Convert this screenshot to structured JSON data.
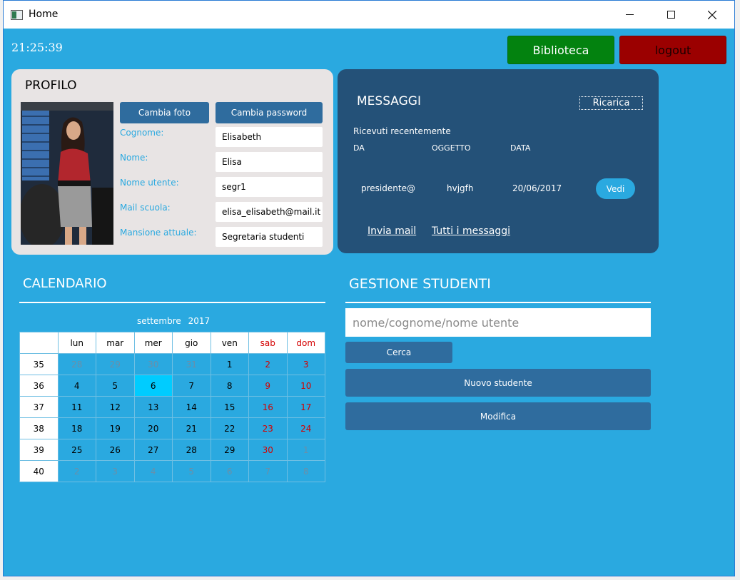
{
  "window": {
    "title": "Home"
  },
  "clock": "21:25:39",
  "top_buttons": {
    "library": "Biblioteca",
    "logout": "logout"
  },
  "colors": {
    "background": "#2aa9e0",
    "library": "#03820f",
    "logout": "#9b0000",
    "panel_dark": "#245178",
    "button": "#2f6c9e",
    "today": "#00ccff",
    "weekend": "#d40000"
  },
  "profile": {
    "title": "PROFILO",
    "change_photo": "Cambia foto",
    "change_password": "Cambia password",
    "fields": [
      {
        "label": "Cognome:",
        "value": "Elisabeth"
      },
      {
        "label": "Nome:",
        "value": "Elisa"
      },
      {
        "label": "Nome utente:",
        "value": "segr1"
      },
      {
        "label": "Mail scuola:",
        "value": "elisa_elisabeth@mail.it"
      },
      {
        "label": "Mansione attuale:",
        "value": "Segretaria studenti"
      }
    ]
  },
  "messages": {
    "title": "MESSAGGI",
    "reload": "Ricarica",
    "recent": "Ricevuti recentemente",
    "columns": [
      "DA",
      "OGGETTO",
      "DATA"
    ],
    "row": {
      "from": "presidente@r",
      "subject": "hvjgfh",
      "date": "20/06/2017",
      "view": "Vedi"
    },
    "send_mail": "Invia mail",
    "all_messages": "Tutti i messaggi"
  },
  "calendar": {
    "title": "CALENDARIO",
    "month": "settembre",
    "year": "2017",
    "days": [
      "lun",
      "mar",
      "mer",
      "gio",
      "ven",
      "sab",
      "dom"
    ],
    "weeks": [
      {
        "n": "35",
        "d": [
          "28",
          "29",
          "30",
          "31",
          "1",
          "2",
          "3"
        ]
      },
      {
        "n": "36",
        "d": [
          "4",
          "5",
          "6",
          "7",
          "8",
          "9",
          "10"
        ]
      },
      {
        "n": "37",
        "d": [
          "11",
          "12",
          "13",
          "14",
          "15",
          "16",
          "17"
        ]
      },
      {
        "n": "38",
        "d": [
          "18",
          "19",
          "20",
          "21",
          "22",
          "23",
          "24"
        ]
      },
      {
        "n": "39",
        "d": [
          "25",
          "26",
          "27",
          "28",
          "29",
          "30",
          "1"
        ]
      },
      {
        "n": "40",
        "d": [
          "2",
          "3",
          "4",
          "5",
          "6",
          "7",
          "8"
        ]
      }
    ],
    "selected": "6"
  },
  "students": {
    "title": "GESTIONE STUDENTI",
    "search_placeholder": "nome/cognome/nome utente",
    "search_button": "Cerca",
    "new_button": "Nuovo studente",
    "edit_button": "Modifica"
  }
}
